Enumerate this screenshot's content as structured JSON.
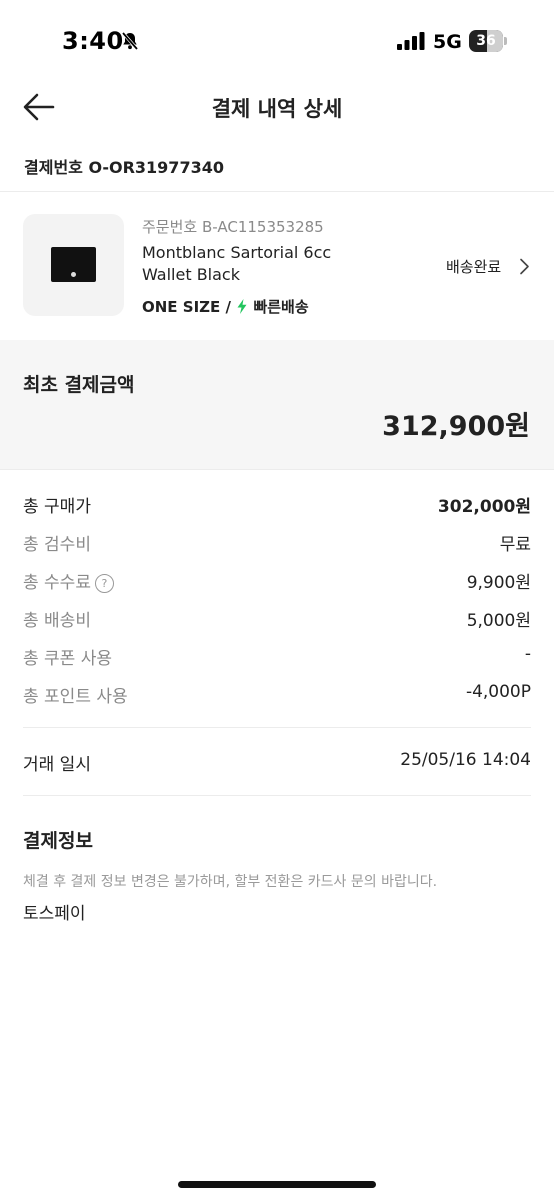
{
  "status_bar": {
    "time": "3:40",
    "network": "5G",
    "battery": "36"
  },
  "header": {
    "title": "결제 내역 상세"
  },
  "payment_number": "결제번호 O-OR31977340",
  "product": {
    "order_number": "주문번호 B-AC115353285",
    "name": "Montblanc Sartorial 6cc Wallet Black",
    "size": "ONE SIZE /",
    "shipping_type": "빠른배송",
    "delivery_status": "배송완료",
    "thumbnail_icon": "wallet-image"
  },
  "summary": {
    "label": "최초 결제금액",
    "amount": "312,900원"
  },
  "breakdown": [
    {
      "label": "총 구매가",
      "value": "302,000원"
    },
    {
      "label": "총 검수비",
      "value": "무료"
    },
    {
      "label": "총 수수료",
      "value": "9,900원"
    },
    {
      "label": "총 배송비",
      "value": "5,000원"
    },
    {
      "label": "총 쿠폰 사용",
      "value": "-"
    },
    {
      "label": "총 포인트 사용",
      "value": "-4,000P"
    }
  ],
  "transaction": {
    "label": "거래 일시",
    "value": "25/05/16 14:04"
  },
  "payment_info": {
    "title": "결제정보",
    "note": "체결 후 결제 정보 변경은 불가하며, 할부 전환은 카드사 문의 바랍니다.",
    "method": "토스페이"
  },
  "colors": {
    "accent_bolt": "#22c55e",
    "muted_text": "#8a8a8a",
    "summary_bg": "#f6f6f6"
  }
}
